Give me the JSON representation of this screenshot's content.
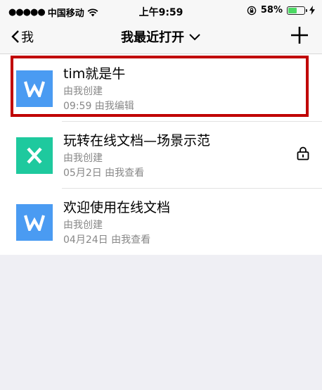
{
  "status_bar": {
    "carrier": "中国移动",
    "time": "上午9:59",
    "battery": "58%",
    "battery_level": 0.58
  },
  "nav": {
    "back_label": "我",
    "title": "我最近打开"
  },
  "documents": [
    {
      "title": "tim就是牛",
      "creator": "由我创建",
      "meta": "09:59 由我编辑",
      "type": "word",
      "locked": false
    },
    {
      "title": "玩转在线文档—场景示范",
      "creator": "由我创建",
      "meta": "05月2日 由我查看",
      "type": "excel",
      "locked": true
    },
    {
      "title": "欢迎使用在线文档",
      "creator": "由我创建",
      "meta": "04月24日 由我查看",
      "type": "word",
      "locked": false
    }
  ],
  "colors": {
    "word": "#4a9bf2",
    "excel": "#1ec99e",
    "highlight": "#c00000",
    "battery": "#4cd964"
  }
}
